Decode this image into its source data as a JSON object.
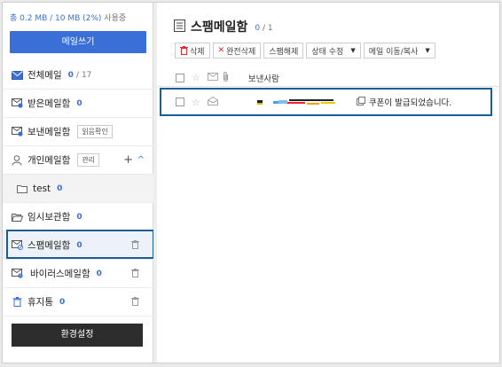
{
  "sidebar": {
    "quota_used": "총 0.2 MB / 10 MB (2%)",
    "quota_suffix": "사용중",
    "compose_label": "메일쓰기",
    "all_mail": {
      "label": "전체메일",
      "unread": "0",
      "total": "/ 17"
    },
    "inbox": {
      "label": "받은메일함",
      "count": "0"
    },
    "sent": {
      "label": "보낸메일함",
      "tag": "읽음확인"
    },
    "personal": {
      "label": "개인메일함",
      "tag": "관리",
      "plus": "+",
      "chevron": "^"
    },
    "test_folder": {
      "label": "test",
      "count": "0"
    },
    "drafts": {
      "label": "임시보관함",
      "count": "0"
    },
    "spam": {
      "label": "스팸메일함",
      "count": "0"
    },
    "virus": {
      "label": "바이러스메일함",
      "count": "0"
    },
    "trash": {
      "label": "휴지통",
      "count": "0"
    },
    "settings_label": "환경설정"
  },
  "main": {
    "title": "스팸메일함",
    "page_current": "0",
    "page_total": "/ 1",
    "toolbar": {
      "delete": "삭제",
      "perm_delete": "완전삭제",
      "unspam": "스팸해제",
      "status": "상태 수정",
      "move": "메일 이동/복사"
    },
    "header_sender": "보낸사람",
    "rows": [
      {
        "subject": "쿠폰이 발급되었습니다."
      }
    ]
  },
  "colors": {
    "accent": "#3a6fd8",
    "highlight": "#1b5e96",
    "danger": "#e02b2b"
  }
}
